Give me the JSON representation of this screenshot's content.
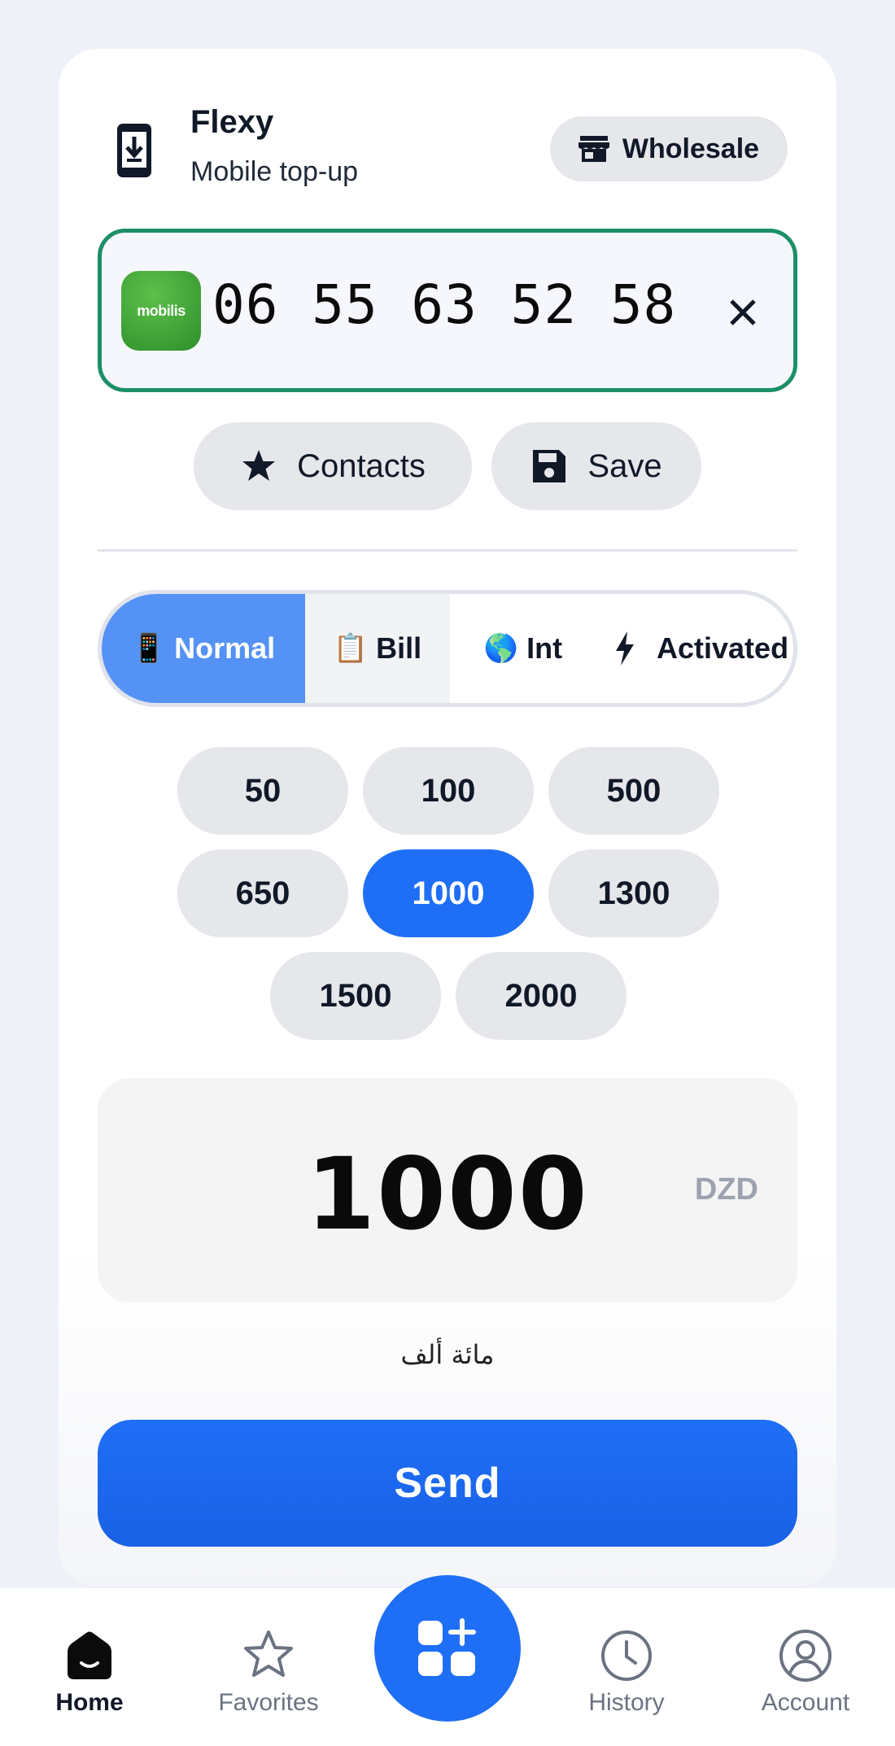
{
  "header": {
    "title": "Flexy",
    "subtitle": "Mobile top-up",
    "wholesale_label": "Wholesale"
  },
  "phone": {
    "number": "06 55 63 52 58",
    "operator_logo_text": "mobilis"
  },
  "actions": {
    "contacts_label": "Contacts",
    "save_label": "Save"
  },
  "tabs": [
    {
      "icon": "📱",
      "label": "Normal",
      "active": true
    },
    {
      "icon": "📋",
      "label": "Bill",
      "active": false
    },
    {
      "icon": "🌎",
      "label": "Int",
      "active": false
    },
    {
      "icon": "lightning-icon",
      "label": "Activated",
      "active": false
    }
  ],
  "amounts": [
    "50",
    "100",
    "500",
    "650",
    "1000",
    "1300",
    "1500",
    "2000"
  ],
  "selected_amount": "1000",
  "amount": {
    "value": "1000",
    "currency": "DZD",
    "words": "مائة ألف"
  },
  "send_label": "Send",
  "nav": {
    "home": "Home",
    "favorites": "Favorites",
    "history": "History",
    "account": "Account"
  },
  "colors": {
    "primary": "#1f6ef6",
    "active_tab": "#5592f5",
    "input_border": "#1c8f67",
    "chip_bg": "#e5e7eb"
  }
}
